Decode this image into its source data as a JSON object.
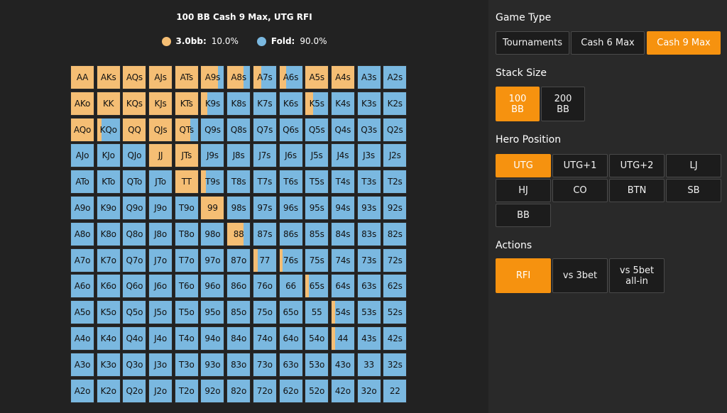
{
  "chart_title": "100 BB Cash 9 Max, UTG RFI",
  "legend": [
    {
      "label": "3.0bb:",
      "value": "10.0%",
      "color": "#f5be74"
    },
    {
      "label": "Fold:",
      "value": "90.0%",
      "color": "#7ab8e0"
    }
  ],
  "colors": {
    "raise": "#f5be74",
    "fold": "#7ab8e0",
    "accent": "#f6920f"
  },
  "hands": [
    [
      "AA",
      "AKs",
      "AQs",
      "AJs",
      "ATs",
      "A9s",
      "A8s",
      "A7s",
      "A6s",
      "A5s",
      "A4s",
      "A3s",
      "A2s"
    ],
    [
      "AKo",
      "KK",
      "KQs",
      "KJs",
      "KTs",
      "K9s",
      "K8s",
      "K7s",
      "K6s",
      "K5s",
      "K4s",
      "K3s",
      "K2s"
    ],
    [
      "AQo",
      "KQo",
      "QQ",
      "QJs",
      "QTs",
      "Q9s",
      "Q8s",
      "Q7s",
      "Q6s",
      "Q5s",
      "Q4s",
      "Q3s",
      "Q2s"
    ],
    [
      "AJo",
      "KJo",
      "QJo",
      "JJ",
      "JTs",
      "J9s",
      "J8s",
      "J7s",
      "J6s",
      "J5s",
      "J4s",
      "J3s",
      "J2s"
    ],
    [
      "ATo",
      "KTo",
      "QTo",
      "JTo",
      "TT",
      "T9s",
      "T8s",
      "T7s",
      "T6s",
      "T5s",
      "T4s",
      "T3s",
      "T2s"
    ],
    [
      "A9o",
      "K9o",
      "Q9o",
      "J9o",
      "T9o",
      "99",
      "98s",
      "97s",
      "96s",
      "95s",
      "94s",
      "93s",
      "92s"
    ],
    [
      "A8o",
      "K8o",
      "Q8o",
      "J8o",
      "T8o",
      "98o",
      "88",
      "87s",
      "86s",
      "85s",
      "84s",
      "83s",
      "82s"
    ],
    [
      "A7o",
      "K7o",
      "Q7o",
      "J7o",
      "T7o",
      "97o",
      "87o",
      "77",
      "76s",
      "75s",
      "74s",
      "73s",
      "72s"
    ],
    [
      "A6o",
      "K6o",
      "Q6o",
      "J6o",
      "T6o",
      "96o",
      "86o",
      "76o",
      "66",
      "65s",
      "64s",
      "63s",
      "62s"
    ],
    [
      "A5o",
      "K5o",
      "Q5o",
      "J5o",
      "T5o",
      "95o",
      "85o",
      "75o",
      "65o",
      "55",
      "54s",
      "53s",
      "52s"
    ],
    [
      "A4o",
      "K4o",
      "Q4o",
      "J4o",
      "T4o",
      "94o",
      "84o",
      "74o",
      "64o",
      "54o",
      "44",
      "43s",
      "42s"
    ],
    [
      "A3o",
      "K3o",
      "Q3o",
      "J3o",
      "T3o",
      "93o",
      "83o",
      "73o",
      "63o",
      "53o",
      "43o",
      "33",
      "32s"
    ],
    [
      "A2o",
      "K2o",
      "Q2o",
      "J2o",
      "T2o",
      "92o",
      "82o",
      "72o",
      "62o",
      "52o",
      "42o",
      "32o",
      "22"
    ]
  ],
  "raise_freq": [
    [
      1,
      1,
      1,
      1,
      1,
      0.75,
      0.7,
      0.35,
      0.3,
      1,
      1,
      0,
      0
    ],
    [
      1,
      1,
      1,
      1,
      1,
      0.28,
      0,
      0,
      0,
      0.35,
      0,
      0,
      0
    ],
    [
      1,
      0.2,
      1,
      1,
      0.65,
      0,
      0,
      0,
      0,
      0,
      0,
      0,
      0
    ],
    [
      0,
      0,
      0,
      1,
      1,
      0,
      0,
      0,
      0,
      0,
      0,
      0,
      0
    ],
    [
      0,
      0,
      0,
      0,
      1,
      0.2,
      0,
      0,
      0,
      0,
      0,
      0,
      0
    ],
    [
      0,
      0,
      0,
      0,
      0,
      1,
      0,
      0,
      0,
      0,
      0,
      0,
      0
    ],
    [
      0,
      0,
      0,
      0,
      0,
      0,
      0.7,
      0,
      0,
      0,
      0,
      0,
      0
    ],
    [
      0,
      0,
      0,
      0,
      0,
      0,
      0,
      0.18,
      0.15,
      0,
      0,
      0,
      0
    ],
    [
      0,
      0,
      0,
      0,
      0,
      0,
      0,
      0,
      0,
      0.15,
      0,
      0,
      0
    ],
    [
      0,
      0,
      0,
      0,
      0,
      0,
      0,
      0,
      0,
      0,
      0.15,
      0,
      0
    ],
    [
      0,
      0,
      0,
      0,
      0,
      0,
      0,
      0,
      0,
      0,
      0.15,
      0,
      0
    ],
    [
      0,
      0,
      0,
      0,
      0,
      0,
      0,
      0,
      0,
      0,
      0,
      0,
      0
    ],
    [
      0,
      0,
      0,
      0,
      0,
      0,
      0,
      0,
      0,
      0,
      0,
      0,
      0
    ]
  ],
  "sidebar": {
    "game_type": {
      "label": "Game Type",
      "options": [
        "Tournaments",
        "Cash 6 Max",
        "Cash 9 Max"
      ],
      "selected": 2
    },
    "stack_size": {
      "label": "Stack Size",
      "options": [
        "100\nBB",
        "200\nBB"
      ],
      "selected": 0
    },
    "hero_position": {
      "label": "Hero Position",
      "options": [
        "UTG",
        "UTG+1",
        "UTG+2",
        "LJ",
        "HJ",
        "CO",
        "BTN",
        "SB",
        "BB"
      ],
      "selected": 0
    },
    "actions": {
      "label": "Actions",
      "options": [
        "RFI",
        "vs 3bet",
        "vs 5bet\nall-in"
      ],
      "selected": 0
    }
  }
}
